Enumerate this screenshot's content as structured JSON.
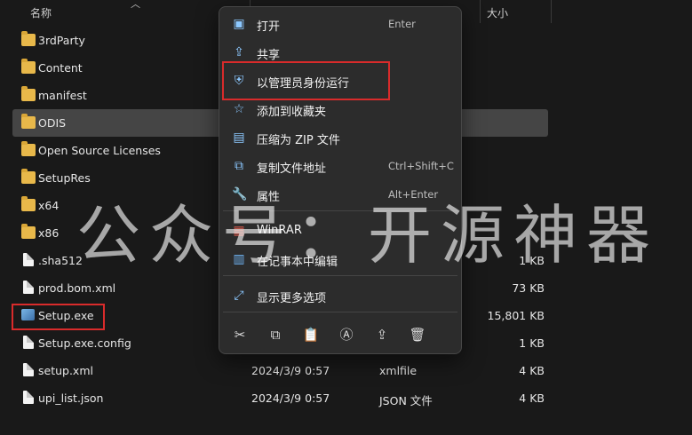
{
  "header": {
    "name_col": "名称",
    "size_col": "大小"
  },
  "files": [
    {
      "name": "3rdParty",
      "kind": "folder",
      "date": "",
      "type": "",
      "size": ""
    },
    {
      "name": "Content",
      "kind": "folder",
      "date": "",
      "type": "",
      "size": ""
    },
    {
      "name": "manifest",
      "kind": "folder",
      "date": "",
      "type": "",
      "size": ""
    },
    {
      "name": "ODIS",
      "kind": "folder",
      "date": "",
      "type": "",
      "size": "",
      "selected": true
    },
    {
      "name": "Open Source Licenses",
      "kind": "folder",
      "date": "",
      "type": "",
      "size": ""
    },
    {
      "name": "SetupRes",
      "kind": "folder",
      "date": "",
      "type": "",
      "size": ""
    },
    {
      "name": "x64",
      "kind": "folder",
      "date": "",
      "type": "",
      "size": ""
    },
    {
      "name": "x86",
      "kind": "folder",
      "date": "",
      "type": "",
      "size": ""
    },
    {
      "name": ".sha512",
      "kind": "file",
      "date": "",
      "type": "",
      "size": "1 KB"
    },
    {
      "name": "prod.bom.xml",
      "kind": "file",
      "date": "",
      "type": "",
      "size": "73 KB"
    },
    {
      "name": "Setup.exe",
      "kind": "exe",
      "date": "",
      "type": "",
      "size": "15,801 KB"
    },
    {
      "name": "Setup.exe.config",
      "kind": "file",
      "date": "",
      "type": "",
      "size": "1 KB"
    },
    {
      "name": "setup.xml",
      "kind": "file",
      "date": "2024/3/9 0:57",
      "type": "xmlfile",
      "size": "4 KB"
    },
    {
      "name": "upi_list.json",
      "kind": "file",
      "date": "2024/3/9 0:57",
      "type": "JSON 文件",
      "size": "4 KB"
    }
  ],
  "menu": {
    "items": [
      {
        "id": "open",
        "label": "打开",
        "shortcut": "Enter",
        "icon": "open-icon",
        "glyph": "▣"
      },
      {
        "id": "share",
        "label": "共享",
        "shortcut": "",
        "icon": "share-icon",
        "glyph": "⇪"
      },
      {
        "id": "run-as-admin",
        "label": "以管理员身份运行",
        "shortcut": "",
        "icon": "shield-icon",
        "glyph": "⛨"
      },
      {
        "id": "add-favorites",
        "label": "添加到收藏夹",
        "shortcut": "",
        "icon": "star-icon",
        "glyph": "☆"
      },
      {
        "id": "compress-zip",
        "label": "压缩为 ZIP 文件",
        "shortcut": "",
        "icon": "zip-icon",
        "glyph": "▤"
      },
      {
        "id": "copy-path",
        "label": "复制文件地址",
        "shortcut": "Ctrl+Shift+C",
        "icon": "copy-path-icon",
        "glyph": "⧉"
      },
      {
        "id": "properties",
        "label": "属性",
        "shortcut": "Alt+Enter",
        "icon": "wrench-icon",
        "glyph": "🔧"
      },
      {
        "id": "winrar",
        "label": "WinRAR",
        "shortcut": "",
        "icon": "winrar-icon",
        "glyph": "▦"
      },
      {
        "id": "notepad",
        "label": "在记事本中编辑",
        "shortcut": "",
        "icon": "notepad-icon",
        "glyph": "▥"
      },
      {
        "id": "more-options",
        "label": "显示更多选项",
        "shortcut": "",
        "icon": "more-options-icon",
        "glyph": "⤢"
      }
    ],
    "toolbar": [
      {
        "id": "cut",
        "icon": "scissors-icon",
        "glyph": "✂"
      },
      {
        "id": "copy",
        "icon": "copy-icon",
        "glyph": "⧉"
      },
      {
        "id": "paste",
        "icon": "paste-icon",
        "glyph": "📋"
      },
      {
        "id": "rename",
        "icon": "rename-icon",
        "glyph": "Ⓐ"
      },
      {
        "id": "share",
        "icon": "share-icon",
        "glyph": "⇪"
      },
      {
        "id": "delete",
        "icon": "trash-icon",
        "glyph": "🗑"
      }
    ]
  },
  "watermark": "公众号：开源神器",
  "colors": {
    "accent": "#8cc8ff",
    "highlight": "#d92b2b",
    "folder": "#e8b84a",
    "selected_row": "#454545"
  }
}
